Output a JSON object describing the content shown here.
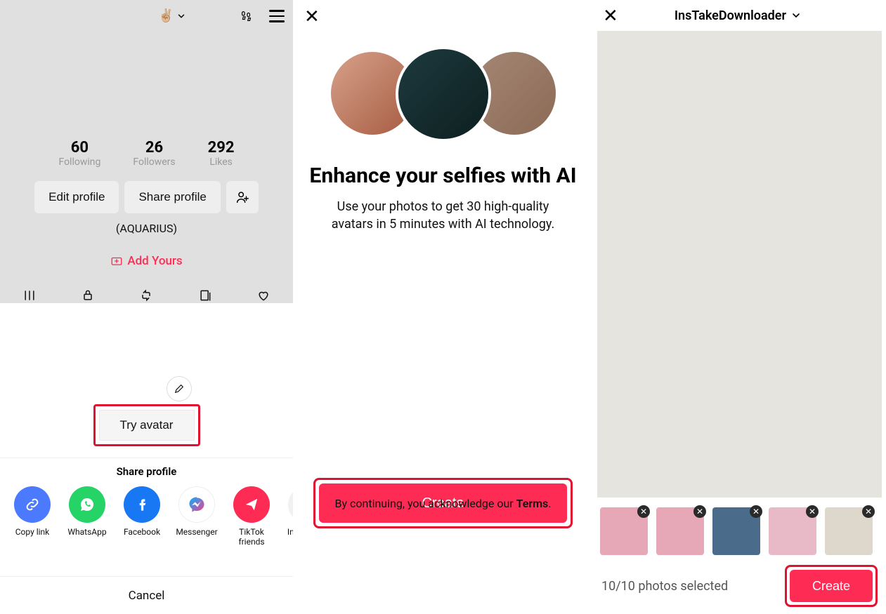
{
  "panel1": {
    "handle_emoji": "✌🏼",
    "stats": {
      "following_num": "60",
      "following_lbl": "Following",
      "followers_num": "26",
      "followers_lbl": "Followers",
      "likes_num": "292",
      "likes_lbl": "Likes"
    },
    "edit_profile": "Edit profile",
    "share_profile": "Share profile",
    "bio": "(AQUARIUS)",
    "add_yours": "Add Yours",
    "try_avatar": "Try avatar",
    "sheet_share_title": "Share profile",
    "share": {
      "copy": "Copy link",
      "whatsapp": "WhatsApp",
      "facebook": "Facebook",
      "messenger": "Messenger",
      "tiktok": "TikTok friends",
      "instagram": "Instagram Direct"
    },
    "cancel": "Cancel"
  },
  "panel2": {
    "heading": "Enhance your selfies with AI",
    "sub": "Use your photos to get 30 high-quality avatars in 5 minutes with AI technology.",
    "create": "Create",
    "terms_prefix": "By continuing, you acknowledge our ",
    "terms_word": "Terms",
    "terms_suffix": "."
  },
  "panel3": {
    "title": "InsTakeDownloader",
    "count": "10/10 photos selected",
    "create": "Create"
  }
}
